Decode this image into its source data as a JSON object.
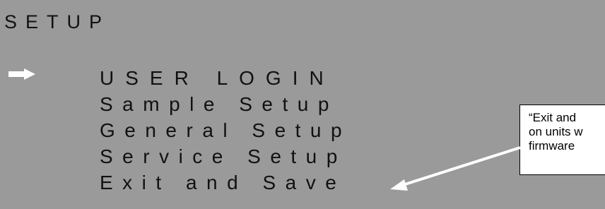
{
  "screen": {
    "title": "SETUP",
    "selected_index": 0,
    "menu": [
      "USER LOGIN",
      "Sample Setup",
      "General Setup",
      "Service Setup",
      "Exit and Save"
    ]
  },
  "callout": {
    "lines": [
      "“Exit and",
      "on units w",
      "firmware"
    ]
  },
  "colors": {
    "screen_bg": "#9a9a9a",
    "text": "#111111",
    "callout_bg": "#ffffff",
    "arrow": "#ffffff"
  },
  "icons": {
    "selection_pointer": "arrow-right-icon"
  }
}
